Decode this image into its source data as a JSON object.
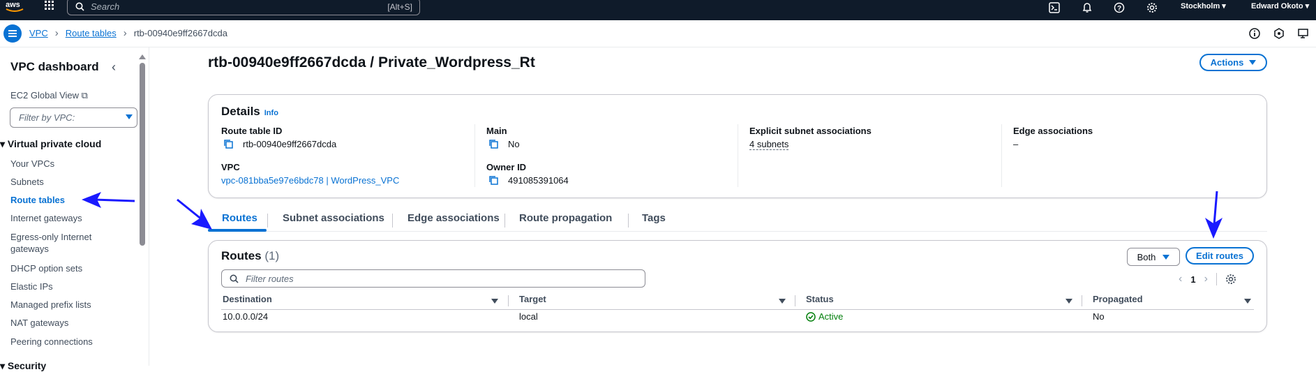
{
  "topbar": {
    "logo": "aws",
    "search_placeholder": "Search",
    "search_shortcut": "[Alt+S]",
    "region": "Stockholm",
    "user": "Edward Okoto",
    "icons": [
      "cloudshell-icon",
      "bell-icon",
      "help-icon",
      "settings-icon"
    ]
  },
  "breadcrumb": {
    "items": [
      "VPC",
      "Route tables"
    ],
    "current": "rtb-00940e9ff2667dcda"
  },
  "sidebar": {
    "title": "VPC dashboard",
    "ec2_global_view": "EC2 Global View",
    "filter_placeholder": "Filter by VPC:",
    "section": "Virtual private cloud",
    "items": [
      "Your VPCs",
      "Subnets",
      "Route tables",
      "Internet gateways",
      "Egress-only Internet gateways",
      "DHCP option sets",
      "Elastic IPs",
      "Managed prefix lists",
      "NAT gateways",
      "Peering connections"
    ],
    "active_item": "Route tables",
    "next_section": "Security"
  },
  "page": {
    "title": "rtb-00940e9ff2667dcda / Private_Wordpress_Rt",
    "actions_label": "Actions"
  },
  "details": {
    "title": "Details",
    "info": "Info",
    "route_table_id_label": "Route table ID",
    "route_table_id": "rtb-00940e9ff2667dcda",
    "main_label": "Main",
    "main": "No",
    "explicit_label": "Explicit subnet associations",
    "explicit": "4 subnets",
    "edge_label": "Edge associations",
    "edge": "–",
    "vpc_label": "VPC",
    "vpc": "vpc-081bba5e97e6bdc78 | WordPress_VPC",
    "owner_label": "Owner ID",
    "owner": "491085391064"
  },
  "tabs": [
    "Routes",
    "Subnet associations",
    "Edge associations",
    "Route propagation",
    "Tags"
  ],
  "routes": {
    "title": "Routes",
    "count": "(1)",
    "both_label": "Both",
    "edit_label": "Edit routes",
    "filter_placeholder": "Filter routes",
    "page": "1",
    "columns": [
      "Destination",
      "Target",
      "Status",
      "Propagated"
    ],
    "rows": [
      {
        "destination": "10.0.0.0/24",
        "target": "local",
        "status": "Active",
        "propagated": "No"
      }
    ]
  },
  "colors": {
    "accent": "#0972d3",
    "topbar": "#0f1b2a",
    "annotation_arrow": "#1a1aff",
    "success": "#037f0c"
  }
}
